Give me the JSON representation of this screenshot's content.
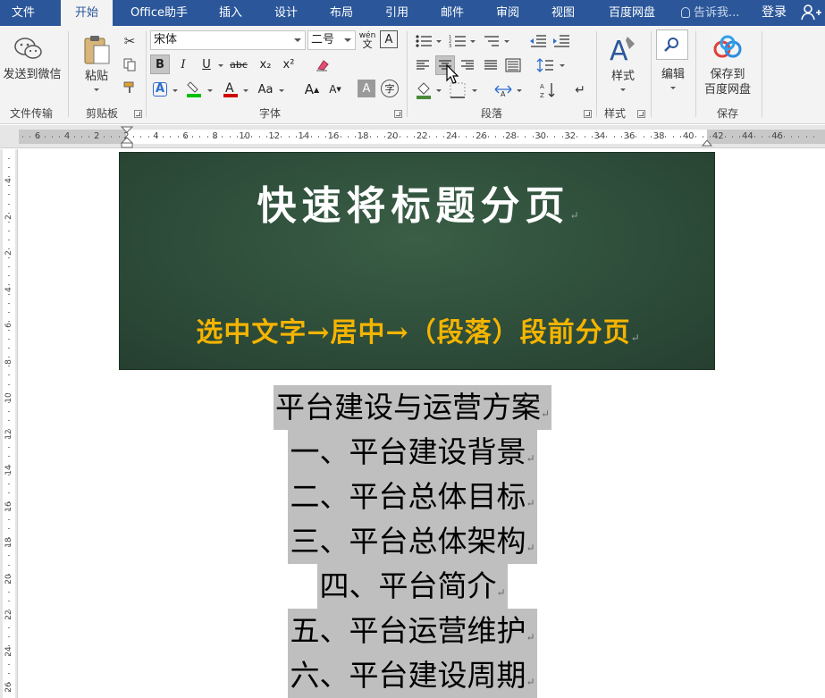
{
  "tabs": [
    {
      "label": "文件",
      "active": false
    },
    {
      "label": "开始",
      "active": true
    },
    {
      "label": "Office助手",
      "active": false
    },
    {
      "label": "插入",
      "active": false
    },
    {
      "label": "设计",
      "active": false
    },
    {
      "label": "布局",
      "active": false
    },
    {
      "label": "引用",
      "active": false
    },
    {
      "label": "邮件",
      "active": false
    },
    {
      "label": "审阅",
      "active": false
    },
    {
      "label": "视图",
      "active": false
    },
    {
      "label": "百度网盘",
      "active": false
    }
  ],
  "tell_me": "告诉我...",
  "login": "登录",
  "ribbon": {
    "wechat_label": "发送到微信",
    "paste_label": "粘贴",
    "font_name": "宋体",
    "font_size": "二号",
    "styles_label": "样式",
    "edit_label": "编辑",
    "save_label_1": "保存到",
    "save_label_2": "百度网盘",
    "groups": {
      "file_transfer": "文件传输",
      "clipboard": "剪贴板",
      "font": "字体",
      "paragraph": "段落",
      "styles": "样式",
      "save": "保存"
    },
    "btn_bold": "B",
    "btn_italic": "I",
    "btn_underline": "U",
    "btn_strike": "abc",
    "btn_sub": "x₂",
    "btn_sup": "x²",
    "btn_case": "Aa",
    "btn_grow": "A",
    "btn_shrink": "A",
    "btn_phonetic": "wén",
    "btn_border_char": "A",
    "btn_shade_char": "A",
    "btn_enclose": "字"
  },
  "ruler": {
    "h_labels": [
      "6",
      "4",
      "2",
      "2",
      "4",
      "6",
      "8",
      "10",
      "12",
      "14",
      "16",
      "18",
      "20",
      "22",
      "24",
      "26",
      "28",
      "30",
      "32",
      "34",
      "36",
      "38",
      "40",
      "42",
      "44",
      "46"
    ],
    "v_labels": [
      "4",
      "2",
      "2",
      "4",
      "6",
      "8",
      "10",
      "12",
      "14",
      "16",
      "18",
      "20",
      "22",
      "24",
      "26"
    ],
    "tab_selector": "L"
  },
  "document": {
    "board_title": "快速将标题分页",
    "board_subtitle": "选中文字→居中→（段落）段前分页",
    "headings": [
      "平台建设与运营方案",
      "一、平台建设背景",
      "二、平台总体目标",
      "三、平台总体架构",
      "四、平台简介",
      "五、平台运营维护",
      "六、平台建设周期"
    ],
    "para_mark": "↵"
  },
  "colors": {
    "tab_bar": "#2b579a",
    "ribbon_bg": "#f3f3f3",
    "board_bg": "#2e4e3a",
    "board_title": "#ffffff",
    "board_subtitle": "#f5b400",
    "highlight": "#bfbfbf"
  }
}
